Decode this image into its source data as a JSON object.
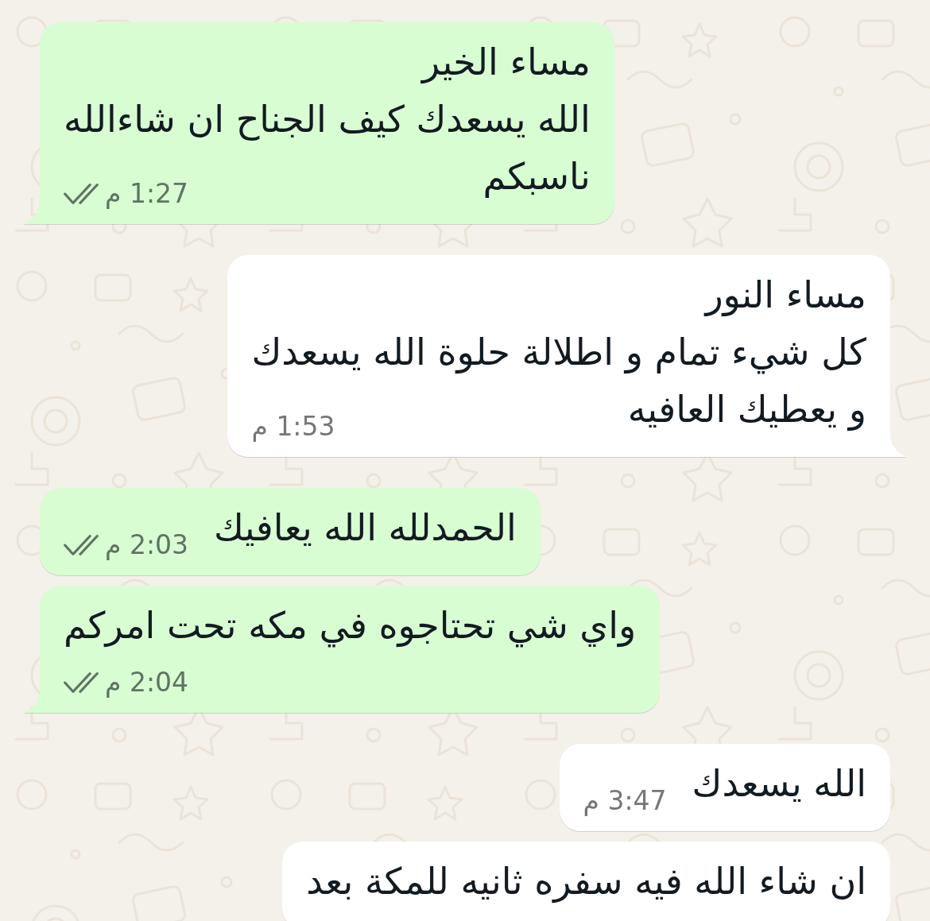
{
  "messages": [
    {
      "outgoing": true,
      "tail": true,
      "lines": [
        "مساء الخير",
        "الله يسعدك كيف الجناح ان شاءالله",
        "ناسبكم"
      ],
      "time": "1:27 م",
      "delivered": true,
      "read": false
    },
    {
      "outgoing": false,
      "tail": true,
      "lines": [
        "مساء النور",
        "كل شيء تمام و اطلالة حلوة الله يسعدك",
        "و يعطيك العافيه"
      ],
      "time": "1:53 م"
    },
    {
      "outgoing": true,
      "tail": false,
      "lines": [
        "الحمدلله الله يعافيك"
      ],
      "time": "2:03 م",
      "delivered": true,
      "read": false
    },
    {
      "outgoing": true,
      "tail": true,
      "lines": [
        "واي شي تحتاجوه في مكه تحت امركم"
      ],
      "time": "2:04 م",
      "delivered": true,
      "read": false
    },
    {
      "outgoing": false,
      "tail": false,
      "lines": [
        "الله يسعدك"
      ],
      "time": "3:47 م"
    },
    {
      "outgoing": false,
      "lines": [
        "ان شاء الله فيه سفره ثانيه للمكة بعد"
      ]
    }
  ]
}
